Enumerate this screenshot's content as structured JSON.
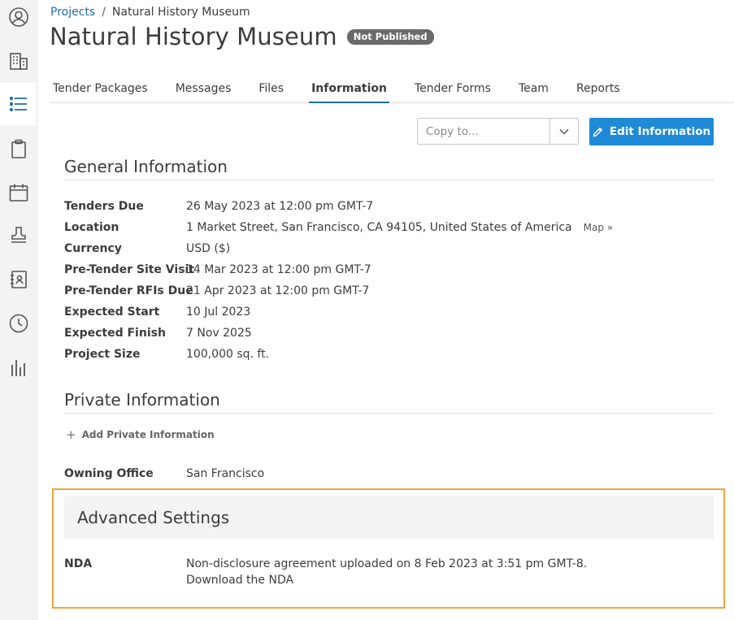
{
  "sidebar": {
    "items": [
      {
        "icon": "user-circle-icon",
        "active": false
      },
      {
        "icon": "building-icon",
        "active": false
      },
      {
        "icon": "list-icon",
        "active": true
      },
      {
        "icon": "clipboard-icon",
        "active": false
      },
      {
        "icon": "calendar-icon",
        "active": false
      },
      {
        "icon": "stamp-icon",
        "active": false
      },
      {
        "icon": "address-book-icon",
        "active": false
      },
      {
        "icon": "clock-icon",
        "active": false
      },
      {
        "icon": "bar-chart-icon",
        "active": false
      }
    ],
    "accent": "#1d6fa5"
  },
  "breadcrumb": {
    "root": "Projects",
    "separator": "/",
    "current": "Natural History Museum"
  },
  "header": {
    "title": "Natural History Museum",
    "badge": "Not Published"
  },
  "tabs": [
    {
      "label": "Tender Packages"
    },
    {
      "label": "Messages"
    },
    {
      "label": "Files"
    },
    {
      "label": "Information",
      "active": true
    },
    {
      "label": "Tender Forms"
    },
    {
      "label": "Team"
    },
    {
      "label": "Reports"
    }
  ],
  "toolbar": {
    "copy_placeholder": "Copy to...",
    "edit_label": "Edit Information",
    "edit_color": "#1f8ad7"
  },
  "general": {
    "title": "General Information",
    "rows": [
      {
        "label": "Tenders Due",
        "value": "26 May 2023 at 12:00 pm GMT-7"
      },
      {
        "label": "Location",
        "value": "1 Market Street, San Francisco, CA 94105, United States of America",
        "link": "Map »"
      },
      {
        "label": "Currency",
        "value": "USD ($)"
      },
      {
        "label": "Pre-Tender Site Visit",
        "value": "14 Mar 2023 at 12:00 pm GMT-7"
      },
      {
        "label": "Pre-Tender RFIs Due",
        "value": "21 Apr 2023 at 12:00 pm GMT-7"
      },
      {
        "label": "Expected Start",
        "value": "10 Jul 2023"
      },
      {
        "label": "Expected Finish",
        "value": "7 Nov 2025"
      },
      {
        "label": "Project Size",
        "value": "100,000 sq. ft."
      }
    ]
  },
  "private": {
    "title": "Private Information",
    "add_label": "Add Private Information",
    "owning_office_label": "Owning Office",
    "owning_office_value": "San Francisco"
  },
  "advanced": {
    "title": "Advanced Settings",
    "nda_label": "NDA",
    "nda_text": "Non-disclosure agreement uploaded on 8 Feb 2023 at 3:51 pm GMT-8.",
    "nda_link": "Download the NDA",
    "highlight_color": "#f2a33a"
  }
}
